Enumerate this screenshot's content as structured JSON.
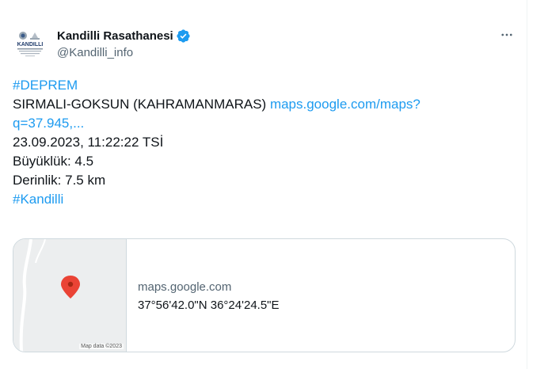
{
  "author": {
    "display_name": "Kandilli Rasathanesi",
    "handle": "@Kandilli_info",
    "logo_text": "KANDILLI",
    "verified_icon": "verified-badge-icon"
  },
  "more_icon": "more-options-icon",
  "tweet": {
    "hashtag_top": "#DEPREM",
    "location_text": "SIRMALI-GOKSUN (KAHRAMANMARAS) ",
    "link_part1": "maps.google.com/maps?",
    "link_part2": "q=37.945,...",
    "datetime": "23.09.2023, 11:22:22 TSİ",
    "magnitude": "Büyüklük: 4.5",
    "depth": "Derinlik: 7.5 km",
    "hashtag_bottom": "#Kandilli"
  },
  "card": {
    "domain": "maps.google.com",
    "title": "37°56'42.0\"N 36°24'24.5\"E",
    "map_credit": "Map data ©2023",
    "pin_icon": "map-pin-icon"
  },
  "colors": {
    "link": "#1d9bf0",
    "text": "#0f1419",
    "secondary": "#536471",
    "pin": "#ea4335"
  }
}
